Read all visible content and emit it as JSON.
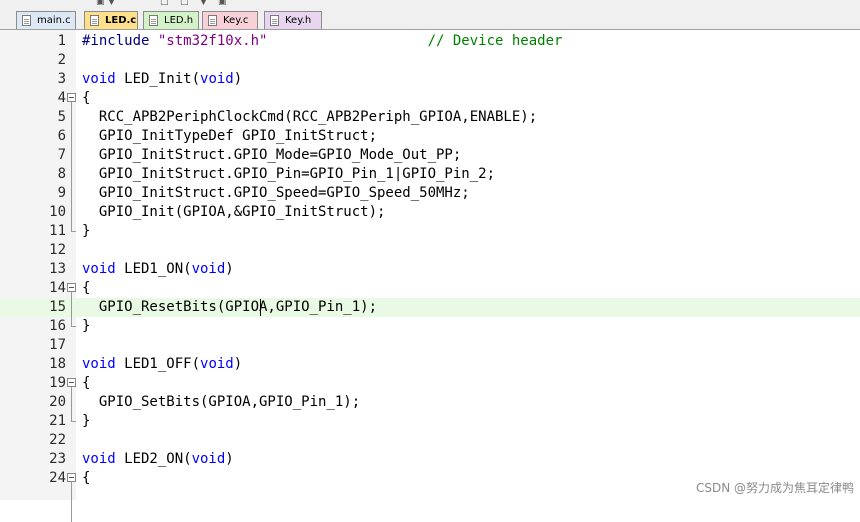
{
  "tabs": [
    {
      "label": "main.c",
      "active": false,
      "color": "#dde8f5"
    },
    {
      "label": "LED.c",
      "active": true,
      "color": "#ffe08a"
    },
    {
      "label": "LED.h",
      "active": false,
      "color": "#d4f2c8"
    },
    {
      "label": "Key.c",
      "active": false,
      "color": "#f7d0d8"
    },
    {
      "label": "Key.h",
      "active": false,
      "color": "#e8d6f0"
    }
  ],
  "current_line": 15,
  "lines": [
    {
      "num": "1",
      "tokens": [
        [
          "dir",
          "#include "
        ],
        [
          "str",
          "\"stm32f10x.h\""
        ],
        [
          "p",
          "                   "
        ],
        [
          "cmt",
          "// Device header"
        ]
      ]
    },
    {
      "num": "2",
      "tokens": []
    },
    {
      "num": "3",
      "tokens": [
        [
          "kw",
          "void"
        ],
        [
          "p",
          " LED_Init("
        ],
        [
          "kw",
          "void"
        ],
        [
          "p",
          ")"
        ]
      ]
    },
    {
      "num": "4",
      "tokens": [
        [
          "p",
          "{"
        ]
      ]
    },
    {
      "num": "5",
      "tokens": [
        [
          "p",
          "  RCC_APB2PeriphClockCmd(RCC_APB2Periph_GPIOA,ENABLE);"
        ]
      ]
    },
    {
      "num": "6",
      "tokens": [
        [
          "p",
          "  GPIO_InitTypeDef GPIO_InitStruct;"
        ]
      ]
    },
    {
      "num": "7",
      "tokens": [
        [
          "p",
          "  GPIO_InitStruct.GPIO_Mode=GPIO_Mode_Out_PP;"
        ]
      ]
    },
    {
      "num": "8",
      "tokens": [
        [
          "p",
          "  GPIO_InitStruct.GPIO_Pin=GPIO_Pin_1|GPIO_Pin_2;"
        ]
      ]
    },
    {
      "num": "9",
      "tokens": [
        [
          "p",
          "  GPIO_InitStruct.GPIO_Speed=GPIO_Speed_50MHz;"
        ]
      ]
    },
    {
      "num": "10",
      "tokens": [
        [
          "p",
          "  GPIO_Init(GPIOA,&GPIO_InitStruct);"
        ]
      ]
    },
    {
      "num": "11",
      "tokens": [
        [
          "p",
          "}"
        ]
      ]
    },
    {
      "num": "12",
      "tokens": []
    },
    {
      "num": "13",
      "tokens": [
        [
          "kw",
          "void"
        ],
        [
          "p",
          " LED1_ON("
        ],
        [
          "kw",
          "void"
        ],
        [
          "p",
          ")"
        ]
      ]
    },
    {
      "num": "14",
      "tokens": [
        [
          "p",
          "{"
        ]
      ]
    },
    {
      "num": "15",
      "tokens": [
        [
          "p",
          "  GPIO_ResetBits(GPIOA,GPIO_Pin_1);"
        ]
      ]
    },
    {
      "num": "16",
      "tokens": [
        [
          "p",
          "}"
        ]
      ]
    },
    {
      "num": "17",
      "tokens": []
    },
    {
      "num": "18",
      "tokens": [
        [
          "kw",
          "void"
        ],
        [
          "p",
          " LED1_OFF("
        ],
        [
          "kw",
          "void"
        ],
        [
          "p",
          ")"
        ]
      ]
    },
    {
      "num": "19",
      "tokens": [
        [
          "p",
          "{"
        ]
      ]
    },
    {
      "num": "20",
      "tokens": [
        [
          "p",
          "  GPIO_SetBits(GPIOA,GPIO_Pin_1);"
        ]
      ]
    },
    {
      "num": "21",
      "tokens": [
        [
          "p",
          "}"
        ]
      ]
    },
    {
      "num": "22",
      "tokens": []
    },
    {
      "num": "23",
      "tokens": [
        [
          "kw",
          "void"
        ],
        [
          "p",
          " LED2_ON("
        ],
        [
          "kw",
          "void"
        ],
        [
          "p",
          ")"
        ]
      ]
    },
    {
      "num": "24",
      "tokens": [
        [
          "p",
          "{"
        ]
      ]
    }
  ],
  "watermark": "CSDN @努力成为焦耳定律鸭"
}
